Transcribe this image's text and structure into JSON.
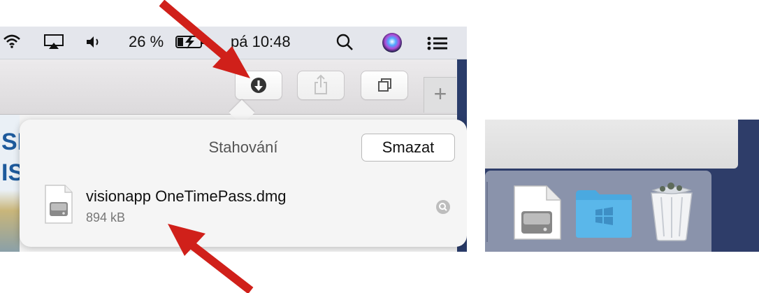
{
  "menubar": {
    "battery_text": "26 %",
    "clock": "pá 10:48",
    "icons": [
      "wifi-icon",
      "airplay-icon",
      "volume-icon",
      "battery-charging-icon",
      "spotlight-search-icon",
      "siri-icon",
      "notification-center-icon"
    ]
  },
  "toolbar": {
    "buttons": [
      "downloads-button",
      "share-button",
      "tabs-overview-button"
    ],
    "new_tab_label": "+"
  },
  "page": {
    "partial_text_1": "SK",
    "partial_text_2": "IS"
  },
  "downloads": {
    "title": "Stahování",
    "clear_label": "Smazat",
    "items": [
      {
        "name": "visionapp OneTimePass.dmg",
        "size": "894 kB",
        "icon": "dmg-file-icon"
      }
    ]
  },
  "dock": {
    "items": [
      {
        "name": "dmg-file",
        "icon": "dmg-file-icon"
      },
      {
        "name": "windows-folder",
        "icon": "windows-folder-icon"
      },
      {
        "name": "trash",
        "icon": "trash-full-icon"
      }
    ]
  },
  "annotations": {
    "arrow_color": "#d0201a"
  },
  "colors": {
    "menubar_bg": "#e4e6ec",
    "desktop_bg": "#2e3d69",
    "popover_bg": "#f5f5f5",
    "folder_blue": "#5ab7ea"
  }
}
